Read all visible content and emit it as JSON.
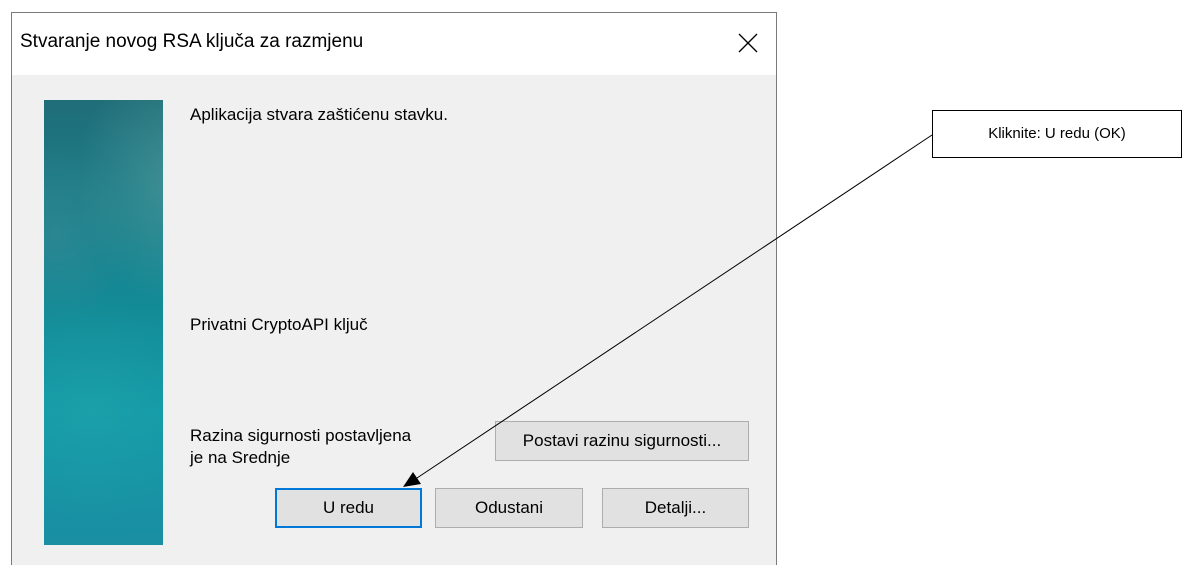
{
  "dialog": {
    "title": "Stvaranje novog RSA ključa za razmjenu",
    "close_icon": "close-icon",
    "message": "Aplikacija stvara zaštićenu stavku.",
    "item_name": "Privatni CryptoAPI ključ",
    "security_line1": "Razina sigurnosti postavljena",
    "security_line2": "je na Srednje",
    "set_security_label": "Postavi razinu sigurnosti...",
    "ok_label": "U redu",
    "cancel_label": "Odustani",
    "details_label": "Detalji..."
  },
  "annotation": {
    "text": "Kliknite: U redu (OK)"
  },
  "colors": {
    "dialog_bg": "#f0f0f0",
    "default_button_border": "#0078d7",
    "button_bg": "#e1e1e1"
  }
}
